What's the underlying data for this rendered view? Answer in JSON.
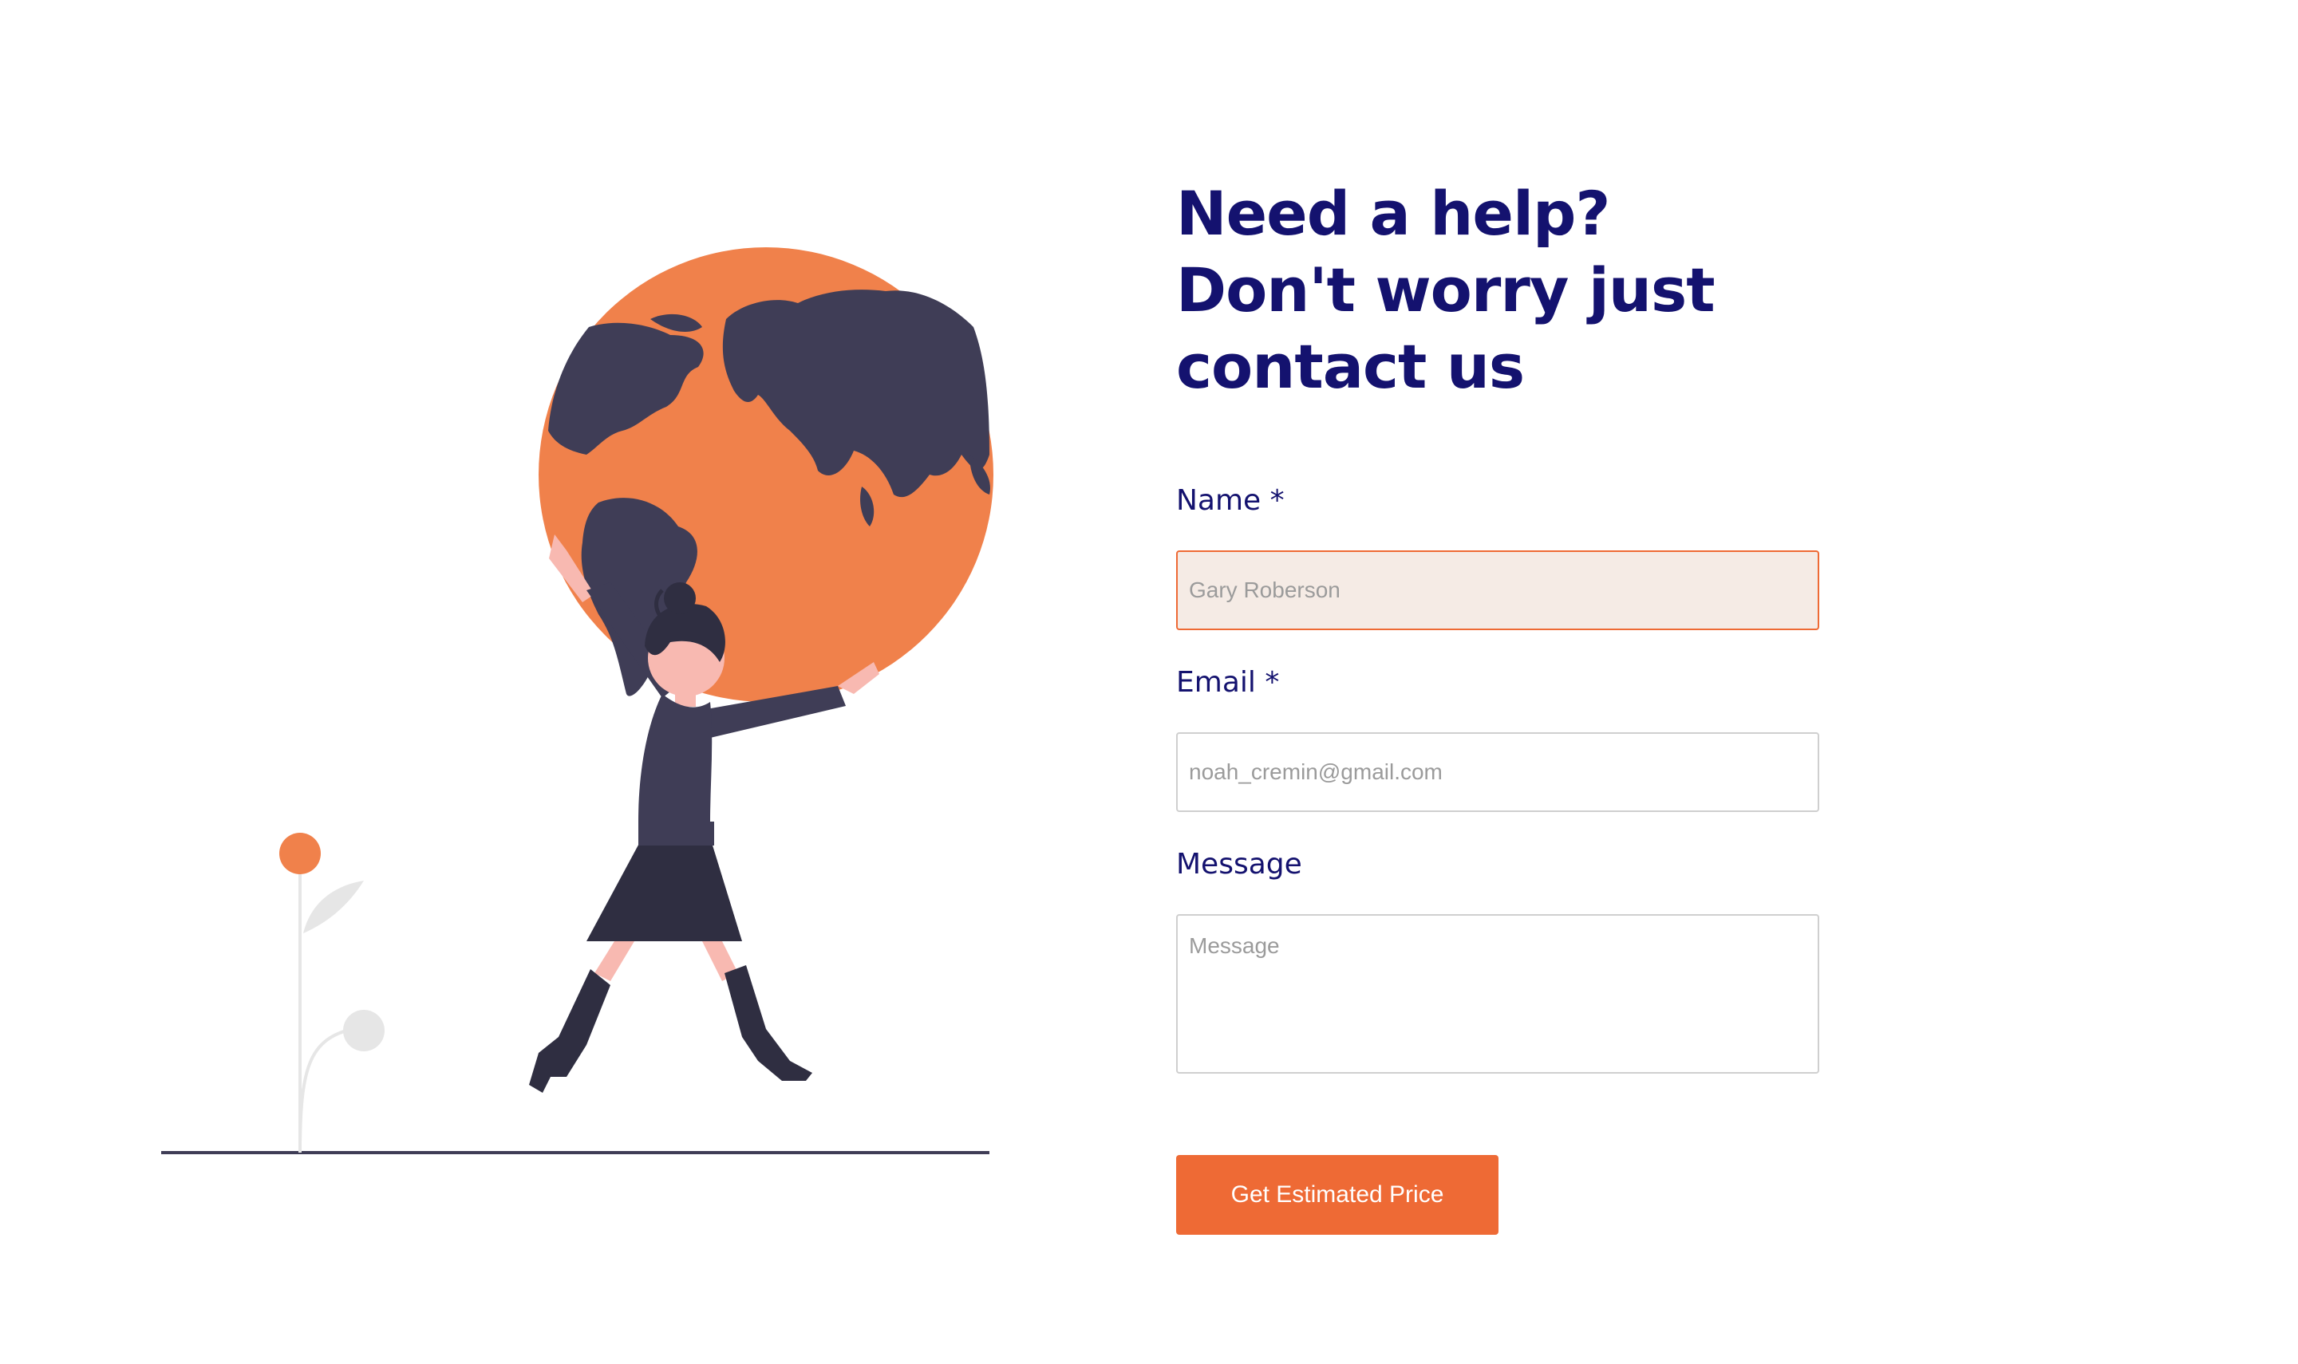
{
  "contact": {
    "heading_line1": "Need a help?",
    "heading_line2": "Don't worry just",
    "heading_line3": "contact us"
  },
  "form": {
    "name_label": "Name *",
    "name_placeholder": "Gary Roberson",
    "email_label": "Email *",
    "email_placeholder": "noah_cremin@gmail.com",
    "message_label": "Message",
    "message_placeholder": "Message",
    "submit_label": "Get Estimated Price"
  },
  "colors": {
    "accent": "#ee6a35",
    "heading": "#14126f",
    "illustration_dark": "#3f3d56",
    "globe": "#f0814b"
  },
  "illustration": {
    "icon": "woman-holding-globe-illustration"
  }
}
